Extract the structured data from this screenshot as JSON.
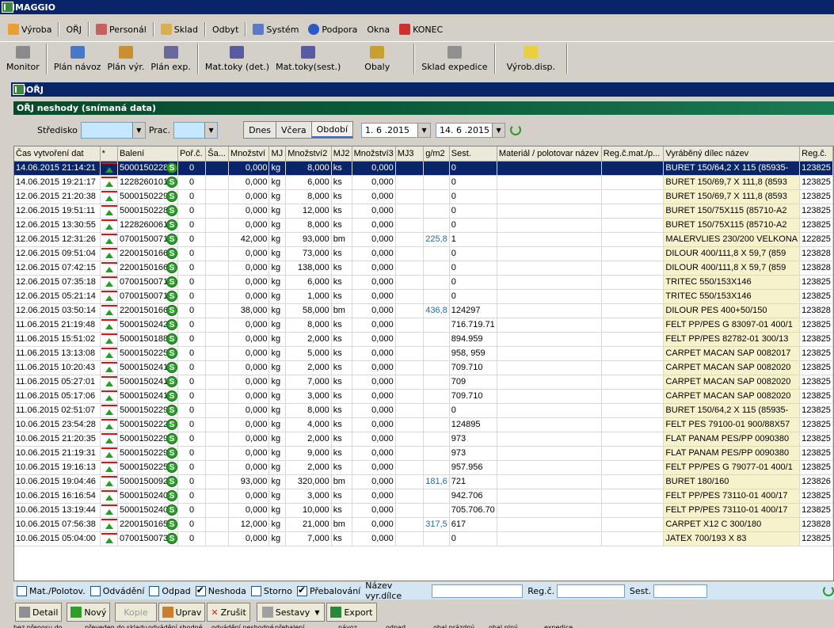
{
  "app_title": "MAGGIO",
  "menu": [
    {
      "label": "Výroba"
    },
    {
      "label": "OŘJ"
    },
    {
      "label": "Personál"
    },
    {
      "label": "Sklad"
    },
    {
      "label": "Odbyt"
    },
    {
      "label": "Systém"
    },
    {
      "label": "Podpora"
    },
    {
      "label": "Okna"
    },
    {
      "label": "KONEC"
    }
  ],
  "toolbar": [
    {
      "label": "Monitor"
    },
    {
      "label": "Plán návoz"
    },
    {
      "label": "Plán výr."
    },
    {
      "label": "Plán exp."
    },
    {
      "label": "Mat.toky (det.)"
    },
    {
      "label": "Mat.toky(sest.)"
    },
    {
      "label": "Obaly"
    },
    {
      "label": "Sklad expedice"
    },
    {
      "label": "Výrob.disp."
    }
  ],
  "window_title": "OŘJ",
  "section_title": "OŘJ neshody (snímaná data)",
  "filters": {
    "stredisko_label": "Středisko",
    "prac_label": "Prac.",
    "tabs": [
      "Dnes",
      "Včera",
      "Období"
    ],
    "date_from": "1. 6 .2015",
    "date_to": "14. 6 .2015"
  },
  "columns": [
    "Čas vytvoření dat",
    "*",
    "Balení",
    "Poř.č.",
    "Ša...",
    "Množství",
    "MJ",
    "Množství2",
    "MJ2",
    "Množství3",
    "MJ3",
    "g/m2",
    "Sest.",
    "Materiál / polotovar název",
    "Reg.č.mat./p...",
    "Vyráběný dílec název",
    "Reg.č."
  ],
  "rows": [
    {
      "time": "14.06.2015 21:14:21",
      "baleni": "50001502289",
      "por": "0",
      "mn": "0,000",
      "mj": "kg",
      "mn2": "8,000",
      "mj2": "ks",
      "mn3": "0,000",
      "gsm": "",
      "sest": "0",
      "vyr": "BURET 150/64,2 X 115 (85935-",
      "reg": "123825"
    },
    {
      "time": "14.06.2015 19:21:17",
      "baleni": "12282601011",
      "por": "0",
      "mn": "0,000",
      "mj": "kg",
      "mn2": "6,000",
      "mj2": "ks",
      "mn3": "0,000",
      "gsm": "",
      "sest": "0",
      "vyr": "BURET 150/69,7 X 111,8 (8593",
      "reg": "123825"
    },
    {
      "time": "12.06.2015 21:20:38",
      "baleni": "50001502290",
      "por": "0",
      "mn": "0,000",
      "mj": "kg",
      "mn2": "8,000",
      "mj2": "ks",
      "mn3": "0,000",
      "gsm": "",
      "sest": "0",
      "vyr": "BURET 150/69,7 X 111,8 (8593",
      "reg": "123825"
    },
    {
      "time": "12.06.2015 19:51:11",
      "baleni": "50001502286",
      "por": "0",
      "mn": "0,000",
      "mj": "kg",
      "mn2": "12,000",
      "mj2": "ks",
      "mn3": "0,000",
      "gsm": "",
      "sest": "0",
      "vyr": "BURET 150/75X115 (85710-A2",
      "reg": "123825"
    },
    {
      "time": "12.06.2015 13:30:55",
      "baleni": "12282600618",
      "por": "0",
      "mn": "0,000",
      "mj": "kg",
      "mn2": "8,000",
      "mj2": "ks",
      "mn3": "0,000",
      "gsm": "",
      "sest": "0",
      "vyr": "BURET 150/75X115 (85710-A2",
      "reg": "123825"
    },
    {
      "time": "12.06.2015 12:31:26",
      "baleni": "07001500712",
      "por": "0",
      "mn": "42,000",
      "mj": "kg",
      "mn2": "93,000",
      "mj2": "bm",
      "mn3": "0,000",
      "gsm": "225,8",
      "sest": "1",
      "vyr": "MALERVLIES 230/200 VELKONA",
      "reg": "122825"
    },
    {
      "time": "12.06.2015 09:51:04",
      "baleni": "22001501662",
      "por": "0",
      "mn": "0,000",
      "mj": "kg",
      "mn2": "73,000",
      "mj2": "ks",
      "mn3": "0,000",
      "gsm": "",
      "sest": "0",
      "vyr": "DILOUR 400/111,8 X 59,7 (859",
      "reg": "123828"
    },
    {
      "time": "12.06.2015 07:42:15",
      "baleni": "22001501662",
      "por": "0",
      "mn": "0,000",
      "mj": "kg",
      "mn2": "138,000",
      "mj2": "ks",
      "mn3": "0,000",
      "gsm": "",
      "sest": "0",
      "vyr": "DILOUR 400/111,8 X 59,7 (859",
      "reg": "123828"
    },
    {
      "time": "12.06.2015 07:35:18",
      "baleni": "07001500712",
      "por": "0",
      "mn": "0,000",
      "mj": "kg",
      "mn2": "6,000",
      "mj2": "ks",
      "mn3": "0,000",
      "gsm": "",
      "sest": "0",
      "vyr": "TRITEC 550/153X146",
      "reg": "123825"
    },
    {
      "time": "12.06.2015 05:21:14",
      "baleni": "07001500712",
      "por": "0",
      "mn": "0,000",
      "mj": "kg",
      "mn2": "1,000",
      "mj2": "ks",
      "mn3": "0,000",
      "gsm": "",
      "sest": "0",
      "vyr": "TRITEC 550/153X146",
      "reg": "123825"
    },
    {
      "time": "12.06.2015 03:50:14",
      "baleni": "22001501660",
      "por": "0",
      "mn": "38,000",
      "mj": "kg",
      "mn2": "58,000",
      "mj2": "bm",
      "mn3": "0,000",
      "gsm": "436,8",
      "sest": "124297",
      "vyr": "DILOUR PES 400+50/150",
      "reg": "123828"
    },
    {
      "time": "11.06.2015 21:19:48",
      "baleni": "50001502421",
      "por": "0",
      "mn": "0,000",
      "mj": "kg",
      "mn2": "8,000",
      "mj2": "ks",
      "mn3": "0,000",
      "gsm": "",
      "sest": "716.719.71",
      "vyr": "FELT PP/PES G 83097-01 400/1",
      "reg": "123825"
    },
    {
      "time": "11.06.2015 15:51:02",
      "baleni": "50001501880",
      "por": "0",
      "mn": "0,000",
      "mj": "kg",
      "mn2": "2,000",
      "mj2": "ks",
      "mn3": "0,000",
      "gsm": "",
      "sest": "894.959",
      "vyr": "FELT PP/PES 82782-01 300/13",
      "reg": "123825"
    },
    {
      "time": "11.06.2015 13:13:08",
      "baleni": "50001502257",
      "por": "0",
      "mn": "0,000",
      "mj": "kg",
      "mn2": "5,000",
      "mj2": "ks",
      "mn3": "0,000",
      "gsm": "",
      "sest": "958, 959",
      "vyr": "CARPET MACAN SAP 0082017",
      "reg": "123825"
    },
    {
      "time": "11.06.2015 10:20:43",
      "baleni": "50001502410",
      "por": "0",
      "mn": "0,000",
      "mj": "kg",
      "mn2": "2,000",
      "mj2": "ks",
      "mn3": "0,000",
      "gsm": "",
      "sest": "709.710",
      "vyr": "CARPET MACAN SAP 0082020",
      "reg": "123825"
    },
    {
      "time": "11.06.2015 05:27:01",
      "baleni": "50001502410",
      "por": "0",
      "mn": "0,000",
      "mj": "kg",
      "mn2": "7,000",
      "mj2": "ks",
      "mn3": "0,000",
      "gsm": "",
      "sest": "709",
      "vyr": "CARPET MACAN SAP 0082020",
      "reg": "123825"
    },
    {
      "time": "11.06.2015 05:17:06",
      "baleni": "50001502410",
      "por": "0",
      "mn": "0,000",
      "mj": "kg",
      "mn2": "3,000",
      "mj2": "ks",
      "mn3": "0,000",
      "gsm": "",
      "sest": "709.710",
      "vyr": "CARPET MACAN SAP 0082020",
      "reg": "123825"
    },
    {
      "time": "11.06.2015 02:51:07",
      "baleni": "50001502294",
      "por": "0",
      "mn": "0,000",
      "mj": "kg",
      "mn2": "8,000",
      "mj2": "ks",
      "mn3": "0,000",
      "gsm": "",
      "sest": "0",
      "vyr": "BURET 150/64,2 X 115 (85935-",
      "reg": "123825"
    },
    {
      "time": "10.06.2015 23:54:28",
      "baleni": "50001502223",
      "por": "0",
      "mn": "0,000",
      "mj": "kg",
      "mn2": "4,000",
      "mj2": "ks",
      "mn3": "0,000",
      "gsm": "",
      "sest": "124895",
      "vyr": "FELT PES 79100-01 900/88X57",
      "reg": "123825"
    },
    {
      "time": "10.06.2015 21:20:35",
      "baleni": "50001502290",
      "por": "0",
      "mn": "0,000",
      "mj": "kg",
      "mn2": "2,000",
      "mj2": "ks",
      "mn3": "0,000",
      "gsm": "",
      "sest": "973",
      "vyr": "FLAT PANAM PES/PP 0090380",
      "reg": "123825"
    },
    {
      "time": "10.06.2015 21:19:31",
      "baleni": "50001502290",
      "por": "0",
      "mn": "0,000",
      "mj": "kg",
      "mn2": "9,000",
      "mj2": "ks",
      "mn3": "0,000",
      "gsm": "",
      "sest": "973",
      "vyr": "FLAT PANAM PES/PP 0090380",
      "reg": "123825"
    },
    {
      "time": "10.06.2015 19:16:13",
      "baleni": "50001502259",
      "por": "0",
      "mn": "0,000",
      "mj": "kg",
      "mn2": "2,000",
      "mj2": "ks",
      "mn3": "0,000",
      "gsm": "",
      "sest": "957.956",
      "vyr": "FELT PP/PES G 79077-01 400/1",
      "reg": "123825"
    },
    {
      "time": "10.06.2015 19:04:46",
      "baleni": "50001500928",
      "por": "0",
      "mn": "93,000",
      "mj": "kg",
      "mn2": "320,000",
      "mj2": "bm",
      "mn3": "0,000",
      "gsm": "181,6",
      "sest": "721",
      "vyr": "BURET 180/160",
      "reg": "123826"
    },
    {
      "time": "10.06.2015 16:16:54",
      "baleni": "50001502406",
      "por": "0",
      "mn": "0,000",
      "mj": "kg",
      "mn2": "3,000",
      "mj2": "ks",
      "mn3": "0,000",
      "gsm": "",
      "sest": "942.706",
      "vyr": "FELT PP/PES 73110-01 400/17",
      "reg": "123825"
    },
    {
      "time": "10.06.2015 13:19:44",
      "baleni": "50001502405",
      "por": "0",
      "mn": "0,000",
      "mj": "kg",
      "mn2": "10,000",
      "mj2": "ks",
      "mn3": "0,000",
      "gsm": "",
      "sest": "705.706.70",
      "vyr": "FELT PP/PES 73110-01 400/17",
      "reg": "123825"
    },
    {
      "time": "10.06.2015 07:56:38",
      "baleni": "22001501659",
      "por": "0",
      "mn": "12,000",
      "mj": "kg",
      "mn2": "21,000",
      "mj2": "bm",
      "mn3": "0,000",
      "gsm": "317,5",
      "sest": "617",
      "vyr": "CARPET X12 C 300/180",
      "reg": "123828"
    },
    {
      "time": "10.06.2015 05:04:00",
      "baleni": "07001500731",
      "por": "0",
      "mn": "0,000",
      "mj": "kg",
      "mn2": "7,000",
      "mj2": "ks",
      "mn3": "0,000",
      "gsm": "",
      "sest": "0",
      "vyr": "JATEX 700/193 X 83",
      "reg": "123825"
    }
  ],
  "checkboxes": [
    {
      "label": "Mat./Polotov.",
      "checked": false
    },
    {
      "label": "Odvádění",
      "checked": false
    },
    {
      "label": "Odpad",
      "checked": false
    },
    {
      "label": "Neshoda",
      "checked": true
    },
    {
      "label": "Storno",
      "checked": false
    },
    {
      "label": "Přebalování",
      "checked": true
    }
  ],
  "search_fields": {
    "nazev_label": "Název vyr.dílce",
    "reg_label": "Reg.č.",
    "sest_label": "Sest."
  },
  "buttons": [
    "Detail",
    "Nový",
    "Kopie",
    "Uprav",
    "Zrušit",
    "Sestavy",
    "Export"
  ],
  "legend": [
    "bez přenosu do skladu",
    "převeden do skladu",
    "odvádění shodné",
    "odvádění neshodné",
    "přebalení",
    "návoz",
    "odpad",
    "obal prázdný",
    "obal plný",
    "expedice"
  ]
}
